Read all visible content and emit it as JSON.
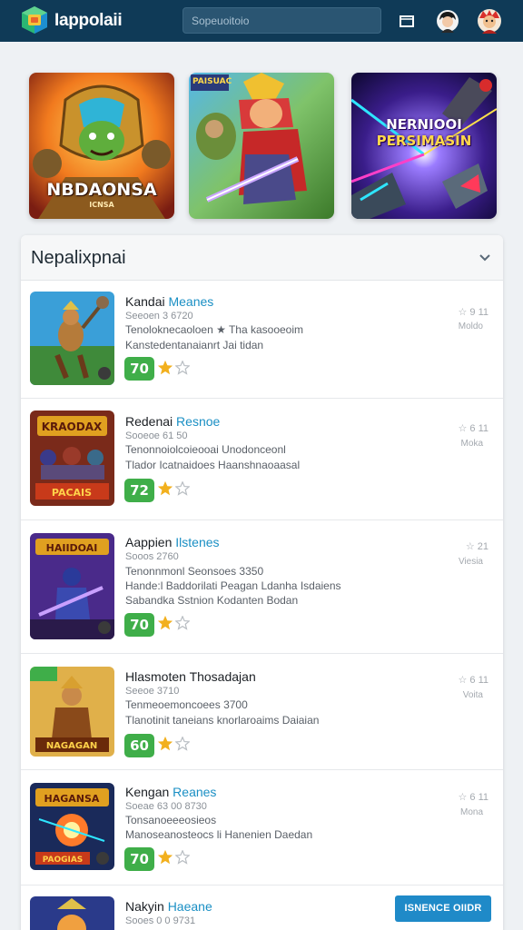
{
  "header": {
    "app_title": "Iappolaii",
    "search_placeholder": "Sopeuoitoio",
    "icons": [
      "app-logo-icon",
      "window-icon",
      "user-avatar-dark",
      "user-avatar-red"
    ]
  },
  "banners": [
    {
      "title": "NBDAONSA",
      "subtitle": "ICNSA"
    },
    {
      "title": "PAISUAC",
      "subtitle": ""
    },
    {
      "title_line1": "NERNIOOI",
      "title_line2": "PERSIMASIN"
    }
  ],
  "panel": {
    "title": "Nepalixpnai"
  },
  "items": [
    {
      "title_a": "Kandai",
      "title_b": "Meanes",
      "sub": "Seeoen 3 6720",
      "desc1": "Tenoloknecaoloen ★ Tha kasooeoim",
      "desc2": "Kanstedentanaianrt Jai tidan",
      "score": "70",
      "rating": "☆ 9 11",
      "label": "Moldo"
    },
    {
      "title_a": "Redenai",
      "title_b": "Resnoe",
      "sub": "Sooeoe 61 50",
      "desc1": "Tenonnoiolcoieooai Unodonceonl",
      "desc2": "Tlador Icatnaidoes Haanshnaoaasal",
      "score": "72",
      "rating": "☆ 6 11",
      "label": "Moka"
    },
    {
      "title_a": "Aappien",
      "title_b": "Ilstenes",
      "sub": "Sooos 2760",
      "desc1": "Tenonnmonl Seonsoes 3350",
      "desc2": "Hande:l Baddorilati Peagan Ldanha Isdaiens",
      "desc3": "Sabandka Sstnion Kodanten Bodan",
      "score": "70",
      "rating": "☆ 21",
      "label": "Viesia"
    },
    {
      "title_a": "Hlasmoten",
      "title_b": "Thosadajan",
      "sub": "Seeoe 3710",
      "desc1": "Tenmeoemoncoees 3700",
      "desc2": "Tlanotinit taneians knorlaroaims Daiaian",
      "score": "60",
      "rating": "☆ 6 11",
      "label": "Voita"
    },
    {
      "title_a": "Kengan",
      "title_b": "Reanes",
      "sub": "Soeae 63 00 8730",
      "desc1": "Tonsanoeeeosieos",
      "desc2": "Manoseanosteocs li Hanenien Daedan",
      "score": "70",
      "rating": "☆ 6 11",
      "label": "Mona"
    },
    {
      "title_a": "Nakyin",
      "title_b": "Haeane",
      "sub": "Sooes 0 0 9731"
    }
  ],
  "action_button": "ISNENCE OIIDR",
  "colors": {
    "header_bg": "#0f3a57",
    "accent_blue": "#1a8fc4",
    "score_green": "#3fae49",
    "star_gold": "#f2b01e",
    "button_blue": "#1f8ac8"
  }
}
